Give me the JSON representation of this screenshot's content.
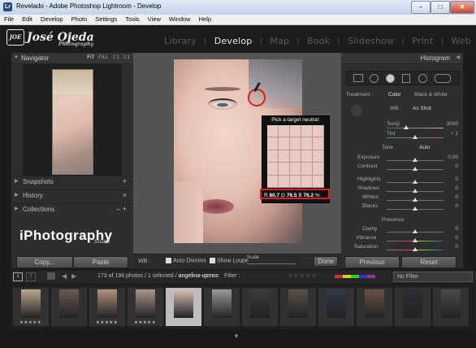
{
  "window": {
    "title": "Revelado - Adobe Photoshop Lightroom - Develop",
    "app_icon": "Lr",
    "controls": {
      "minimize": "–",
      "maximize": "□",
      "close": "✕"
    }
  },
  "menu": [
    "File",
    "Edit",
    "Develop",
    "Photo",
    "Settings",
    "Tools",
    "View",
    "Window",
    "Help"
  ],
  "identity_plate": {
    "name": "José Ojeda",
    "sub": "Photography",
    "cam": "JOE"
  },
  "modules": [
    "Library",
    "Develop",
    "Map",
    "Book",
    "Slideshow",
    "Print",
    "Web"
  ],
  "active_module": "Develop",
  "left_panel": {
    "navigator": {
      "label": "Navigator",
      "options": [
        "FIT",
        "FILL",
        "1:1",
        "2:1"
      ]
    },
    "sections": [
      {
        "label": "Snapshots",
        "control": "+"
      },
      {
        "label": "History",
        "control": "×"
      },
      {
        "label": "Collections",
        "control": "– +"
      }
    ],
    "brand": "iPhotography",
    "brand_sub": "Studio",
    "copy_button": "Copy...",
    "paste_button": "Paste"
  },
  "loupe": {
    "title": "Pick a target neutral:",
    "r_label": "R",
    "r_value": "80.7",
    "g_label": "G",
    "g_value": "76.5",
    "b_label": "B",
    "b_value": "76.2",
    "unit": "%"
  },
  "center_toolbar": {
    "wb_label": "WB :",
    "auto_dismiss": "Auto Dismiss",
    "show_loupe": "Show Loupe",
    "scale": "Scale",
    "done": "Done"
  },
  "right_panel": {
    "histogram": "Histogram",
    "treatment_label": "Treatment :",
    "treatment_color": "Color",
    "treatment_bw": "Black & White",
    "wb_label": "WB :",
    "wb_value": "As Shot",
    "temp_label": "Temp",
    "temp_value": "3000",
    "tint_label": "Tint",
    "tint_value": "+ 1",
    "tone_label": "Tone",
    "tone_auto": "Auto",
    "exposure_label": "Exposure",
    "exposure_value": "0.00",
    "contrast_label": "Contrast",
    "contrast_value": "0",
    "highlights_label": "Highlights",
    "highlights_value": "0",
    "shadows_label": "Shadows",
    "shadows_value": "0",
    "whites_label": "Whites",
    "whites_value": "0",
    "blacks_label": "Blacks",
    "blacks_value": "0",
    "presence_label": "Presence",
    "clarity_label": "Clarity",
    "clarity_value": "0",
    "vibrance_label": "Vibrance",
    "vibrance_value": "0",
    "saturation_label": "Saturation",
    "saturation_value": "0",
    "previous_button": "Previous",
    "reset_button": "Reset"
  },
  "filmstrip_bar": {
    "page1": "1",
    "page2": "2",
    "photo_count": "173 of 196 photos / 1 selected /",
    "filename": "angelina-upmoc",
    "filter_label": "Filter :",
    "no_filter": "No Filter"
  },
  "filmstrip": {
    "thumb_colors": [
      "#b9a58f",
      "#6b5a50",
      "#b29280",
      "#a8968a",
      "#d7bfb5",
      "#9a9a9a",
      "#3e3b3d",
      "#5a5048",
      "#2f3a44",
      "#6a5347",
      "#2d2d33",
      "#4c4a48"
    ],
    "stars": "★★★★★"
  },
  "colors": {
    "accent_red": "#d92020",
    "panel_bg": "#2e2e2e"
  }
}
